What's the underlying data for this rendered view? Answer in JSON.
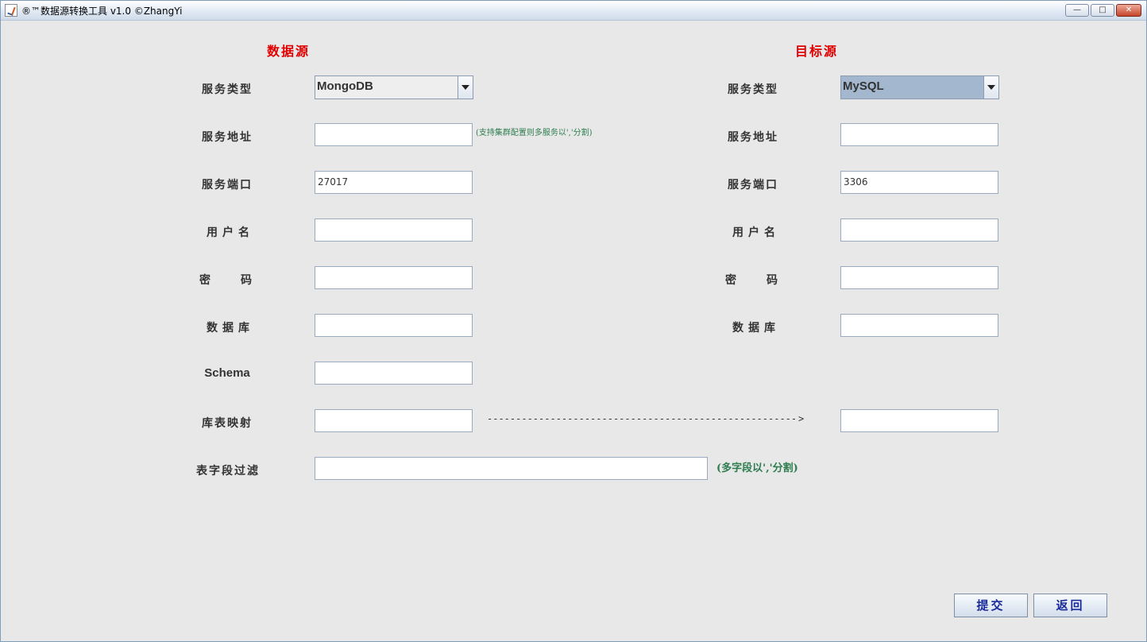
{
  "window": {
    "title": "®™数据源转换工具 v1.0 ©ZhangYi",
    "min_glyph": "—",
    "max_glyph": "□",
    "close_glyph": "✕"
  },
  "source": {
    "heading": "数据源",
    "labels": {
      "service_type": "服务类型",
      "service_address": "服务地址",
      "service_port": "服务端口",
      "username": "用户名",
      "password": "密码",
      "database": "数据库",
      "schema": "Schema",
      "table_mapping": "库表映射",
      "field_filter": "表字段过滤"
    },
    "service_type_value": "MongoDB",
    "address_value": "",
    "address_hint": "(支持集群配置则多服务以','分割)",
    "port_value": "27017",
    "username_value": "",
    "password_value": "",
    "database_value": "",
    "schema_value": "",
    "table_mapping_value": "",
    "field_filter_value": "",
    "field_filter_hint": "(多字段以','分割)"
  },
  "mapping_arrow": "-----------------------------------------------------------------------------------------------------",
  "target": {
    "heading": "目标源",
    "labels": {
      "service_type": "服务类型",
      "service_address": "服务地址",
      "service_port": "服务端口",
      "username": "用户名",
      "password": "密码",
      "database": "数据库"
    },
    "service_type_value": "MySQL",
    "address_value": "",
    "port_value": "3306",
    "username_value": "",
    "password_value": "",
    "database_value": "",
    "table_mapping_value": ""
  },
  "buttons": {
    "submit": "提交",
    "back": "返回"
  }
}
